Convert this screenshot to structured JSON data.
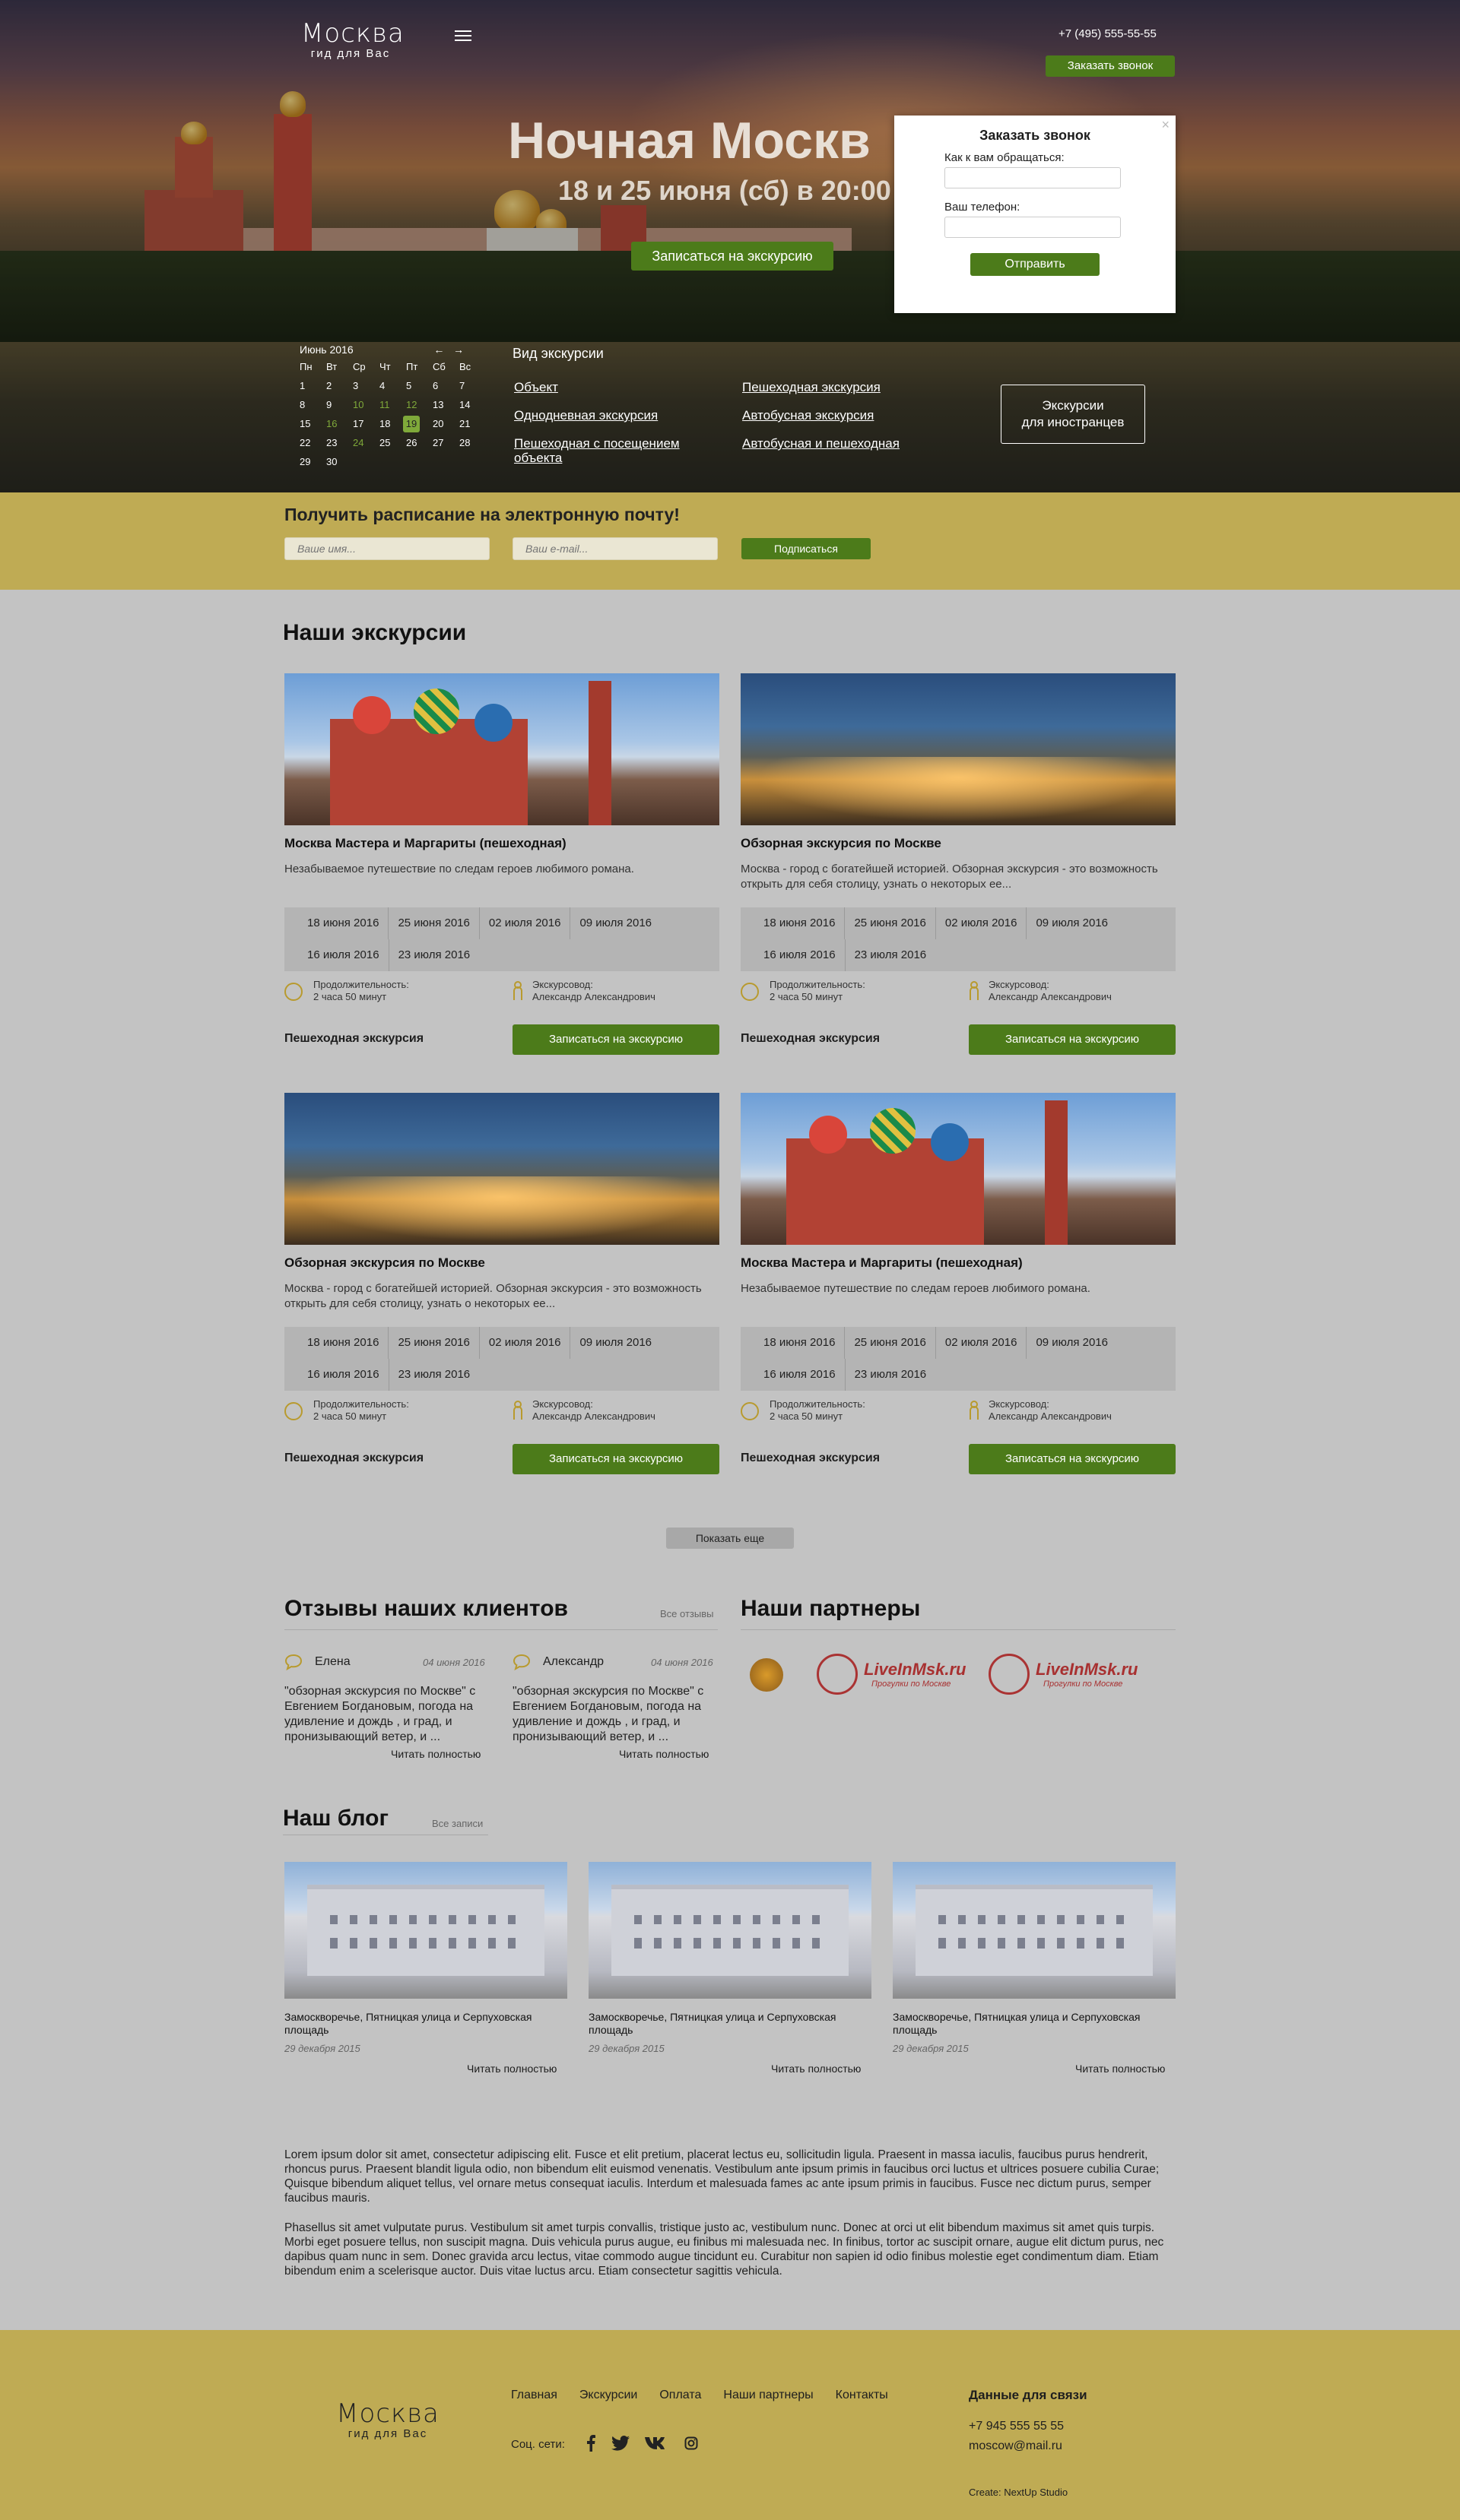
{
  "header": {
    "logo_title": "Москва",
    "logo_sub": "гид для Вас",
    "phone": "+7 (495) 555-55-55",
    "callback_btn": "Заказать звонок"
  },
  "hero": {
    "title": "Ночная Москв",
    "subtitle": "18 и 25 июня (сб) в 20:00",
    "cta": "Записаться на экскурсию"
  },
  "popup": {
    "title": "Заказать звонок",
    "name_label": "Как к вам обращаться:",
    "phone_label": "Ваш телефон:",
    "submit": "Отправить",
    "close": "×"
  },
  "calendar": {
    "month": "Июнь 2016",
    "prev": "←",
    "next": "→",
    "weekdays": [
      "Пн",
      "Вт",
      "Ср",
      "Чт",
      "Пт",
      "Сб",
      "Вс"
    ],
    "weeks": [
      [
        "1",
        "2",
        "3",
        "4",
        "5",
        "6",
        "7"
      ],
      [
        "8",
        "9",
        "10",
        "11",
        "12",
        "13",
        "14"
      ],
      [
        "15",
        "16",
        "17",
        "18",
        "19",
        "20",
        "21"
      ],
      [
        "22",
        "23",
        "24",
        "25",
        "26",
        "27",
        "28"
      ],
      [
        "29",
        "30",
        "",
        "",
        "",
        "",
        ""
      ]
    ],
    "highlight": "#7fa93a"
  },
  "filter": {
    "title": "Вид экскурсии",
    "col1": [
      "Объект",
      "Однодневная экскурсия",
      "Пешеходная с посещением объекта"
    ],
    "col2": [
      "Пешеходная экскурсия",
      "Автобусная экскурсия",
      "Автобусная и пешеходная"
    ],
    "foreign_btn_line1": "Экскурсии",
    "foreign_btn_line2": "для иностранцев"
  },
  "subscribe": {
    "title": "Получить расписание на электронную почту!",
    "name_placeholder": "Ваше имя...",
    "email_placeholder": "Ваш e-mail...",
    "button": "Подписаться"
  },
  "tours": {
    "title": "Наши экскурсии",
    "show_more": "Показать еще",
    "duration_label": "Продолжительность:",
    "duration": "2 часа 50 минут",
    "guide_label": "Экскурсовод:",
    "guide": "Александр Александрович",
    "cta": "Записаться на экскурсию",
    "type": "Пешеходная экскурсия",
    "items": [
      {
        "title": "Москва Мастера и Маргариты (пешеходная)",
        "desc": "Незабываемое путешествие по следам героев любимого романа.",
        "image": "cathedral",
        "dates": [
          "18 июня 2016",
          "25 июня 2016",
          "02 июля 2016",
          "09 июля 2016",
          "16 июля 2016",
          "23 июля 2016"
        ]
      },
      {
        "title": "Обзорная экскурсия по Москве",
        "desc": "Москва - город с богатейшей историей. Обзорная экскурсия - это возможность открыть для себя столицу, узнать о некоторых ее...",
        "image": "night-city",
        "dates": [
          "18 июня 2016",
          "25 июня 2016",
          "02 июля 2016",
          "09 июля 2016",
          "16 июля 2016",
          "23 июля 2016"
        ]
      },
      {
        "title": "Обзорная экскурсия по Москве",
        "desc": "Москва - город с богатейшей историей. Обзорная экскурсия - это возможность открыть для себя столицу, узнать о некоторых ее...",
        "image": "night-city",
        "dates": [
          "18 июня 2016",
          "25 июня 2016",
          "02 июля 2016",
          "09 июля 2016",
          "16 июля 2016",
          "23 июля 2016"
        ]
      },
      {
        "title": "Москва Мастера и Маргариты (пешеходная)",
        "desc": "Незабываемое путешествие по следам героев любимого романа.",
        "image": "cathedral",
        "dates": [
          "18 июня 2016",
          "25 июня 2016",
          "02 июля 2016",
          "09 июля 2016",
          "16 июля 2016",
          "23 июля 2016"
        ]
      }
    ]
  },
  "reviews": {
    "title": "Отзывы наших клиентов",
    "all": "Все отзывы",
    "read_more": "Читать полностью",
    "items": [
      {
        "name": "Елена",
        "date": "04 июня 2016",
        "text": "\"обзорная экскурсия по Москве\" с Евгением Богдановым, погода на удивление и дождь , и град, и пронизывающий ветер, и ..."
      },
      {
        "name": "Александр",
        "date": "04 июня 2016",
        "text": "\"обзорная экскурсия по Москве\" с Евгением Богдановым, погода на удивление и дождь , и град, и пронизывающий ветер, и ..."
      }
    ]
  },
  "partners": {
    "title": "Наши партнеры",
    "logo_text": "LiveInMsk.ru",
    "logo_sub": "Прогулки по Москве"
  },
  "blog": {
    "title": "Наш блог",
    "all": "Все записи",
    "read_more": "Читать полностью",
    "items": [
      {
        "title": "Замоскворечье, Пятницкая улица и Серпуховская площадь",
        "date": "29 декабря 2015"
      },
      {
        "title": "Замоскворечье, Пятницкая улица и Серпуховская площадь",
        "date": "29 декабря 2015"
      },
      {
        "title": "Замоскворечье, Пятницкая улица и Серпуховская площадь",
        "date": "29 декабря 2015"
      }
    ]
  },
  "seo": {
    "p1": "Lorem ipsum dolor sit amet, consectetur adipiscing elit. Fusce et elit pretium, placerat lectus eu, sollicitudin ligula. Praesent in massa iaculis, faucibus purus hendrerit, rhoncus purus. Praesent blandit ligula odio, non bibendum elit euismod venenatis. Vestibulum ante ipsum primis in faucibus orci luctus et ultrices posuere cubilia Curae; Quisque bibendum aliquet tellus, vel ornare metus consequat iaculis. Interdum et malesuada fames ac ante ipsum primis in faucibus. Fusce nec dictum purus, semper faucibus mauris.",
    "p2": "Phasellus sit amet vulputate purus. Vestibulum sit amet turpis convallis, tristique justo ac, vestibulum nunc. Donec at orci ut elit bibendum maximus sit amet quis turpis. Morbi eget posuere tellus, non suscipit magna. Duis vehicula purus augue, eu finibus mi malesuada nec. In finibus, tortor ac suscipit ornare, augue elit dictum purus, nec dapibus quam nunc in sem. Donec gravida arcu lectus, vitae commodo augue tincidunt eu. Curabitur non sapien id odio finibus molestie eget condimentum diam. Etiam bibendum enim a scelerisque auctor. Duis vitae luctus arcu. Etiam consectetur sagittis vehicula."
  },
  "footer": {
    "logo_title": "Москва",
    "logo_sub": "гид для Вас",
    "nav": [
      "Главная",
      "Экскурсии",
      "Оплата",
      "Наши партнеры",
      "Контакты"
    ],
    "social_label": "Соц. сети:",
    "social": [
      "facebook-icon",
      "twitter-icon",
      "vk-icon",
      "instagram-icon"
    ],
    "contacts_title": "Данные для связи",
    "phone": "+7 945 555 55 55",
    "email": "moscow@mail.ru",
    "credit": "Create: NextUp Studio"
  },
  "colors": {
    "accent": "#4c7b1a",
    "gold": "#bfab54",
    "page": "#c3c3c3"
  }
}
